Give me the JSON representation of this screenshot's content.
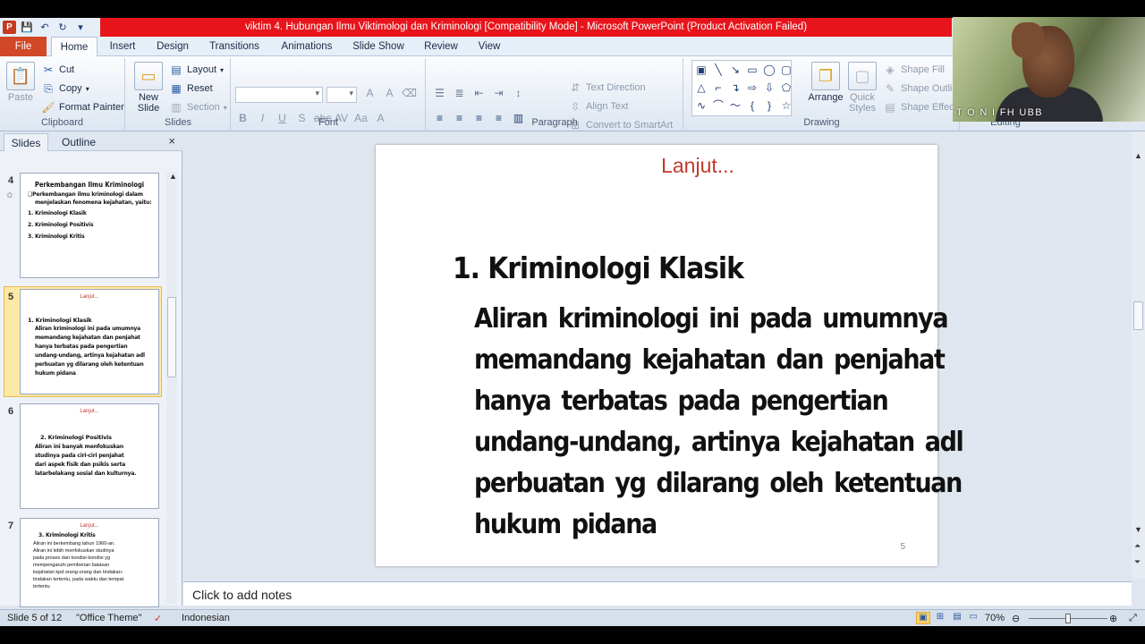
{
  "window": {
    "title": "viktim 4. Hubungan Ilmu Viktimologi dan Kriminologi [Compatibility Mode] - Microsoft PowerPoint (Product Activation Failed)"
  },
  "ribbon_tabs": [
    "File",
    "Home",
    "Insert",
    "Design",
    "Transitions",
    "Animations",
    "Slide Show",
    "Review",
    "View"
  ],
  "ribbon": {
    "clipboard": {
      "label": "Clipboard",
      "paste": "Paste",
      "cut": "Cut",
      "copy": "Copy",
      "format_painter": "Format Painter"
    },
    "slides": {
      "label": "Slides",
      "new_slide_line1": "New",
      "new_slide_line2": "Slide",
      "layout": "Layout",
      "reset": "Reset",
      "section": "Section"
    },
    "font": {
      "label": "Font"
    },
    "paragraph": {
      "label": "Paragraph",
      "text_direction": "Text Direction",
      "align_text": "Align Text",
      "convert_smartart": "Convert to SmartArt"
    },
    "drawing": {
      "label": "Drawing",
      "arrange": "Arrange",
      "quick_styles_line1": "Quick",
      "quick_styles_line2": "Styles",
      "shape_fill": "Shape Fill",
      "shape_outline": "Shape Outli",
      "shape_effects": "Shape Effect"
    },
    "editing": {
      "label": "Editing"
    }
  },
  "panel": {
    "tab_slides": "Slides",
    "tab_outline": "Outline",
    "close": "×"
  },
  "thumbnails": [
    {
      "num": "4",
      "title": "Perkembangan  Ilmu  Kriminologi",
      "lines": [
        "❑Perkembangan ilmu kriminologi dalam",
        "menjelaskan fenomena kejahatan, yaitu:",
        "1. Kriminologi Klasik",
        "2. Kriminologi Positivis",
        "3. Kriminologi Kritis"
      ]
    },
    {
      "num": "5",
      "red": "Lanjut...",
      "lines": [
        "1. Kriminologi Klasik",
        "Aliran kriminologi ini pada umumnya",
        "memandang kejahatan dan penjahat",
        "hanya terbatas pada pengertian",
        "undang-undang, artinya kejahatan adl",
        "perbuatan yg dilarang oleh ketentuan",
        "hukum pidana"
      ]
    },
    {
      "num": "6",
      "red": "Lanjut...",
      "lines": [
        "2. Kriminologi  Positivis",
        "Aliran ini banyak  menfokuskan",
        "studinya  pada ciri-ciri  penjahat",
        "dari aspek fisik dan  psikis serta",
        "latarbelakang   sosial dan kulturnya."
      ]
    },
    {
      "num": "7",
      "red": "Lanjut...",
      "lines": [
        "3. Kriminologi Kritis",
        "Aliran ini berkembang tahun 1960-an.",
        "Aliran ini lebih menfokuskan studinya",
        "pada proses dan kondisi-kondisi yg",
        "mempengaruhi pemberian batasan",
        "kejahatan kpd orang-orang dan tindakan-",
        "tindakan tertentu, pada waktu dan tempat",
        "tertentu"
      ]
    }
  ],
  "slide": {
    "title": "Lanjut...",
    "heading": "1. Kriminologi  Klasik",
    "body": [
      "Aliran  kriminologi  ini  pada  umumnya",
      "memandang  kejahatan  dan  penjahat",
      "hanya  terbatas  pada  pengertian",
      "undang-undang,  artinya  kejahatan  adl",
      "perbuatan  yg  dilarang  oleh  ketentuan",
      "hukum  pidana"
    ],
    "number": "5"
  },
  "notes": {
    "placeholder": "Click to add notes"
  },
  "status": {
    "slide_info": "Slide 5 of 12",
    "theme": "\"Office Theme\"",
    "language": "Indonesian",
    "zoom": "70%",
    "zoom_fraction": 0.5
  },
  "webcam": {
    "name": "T O N I FH UBB"
  }
}
